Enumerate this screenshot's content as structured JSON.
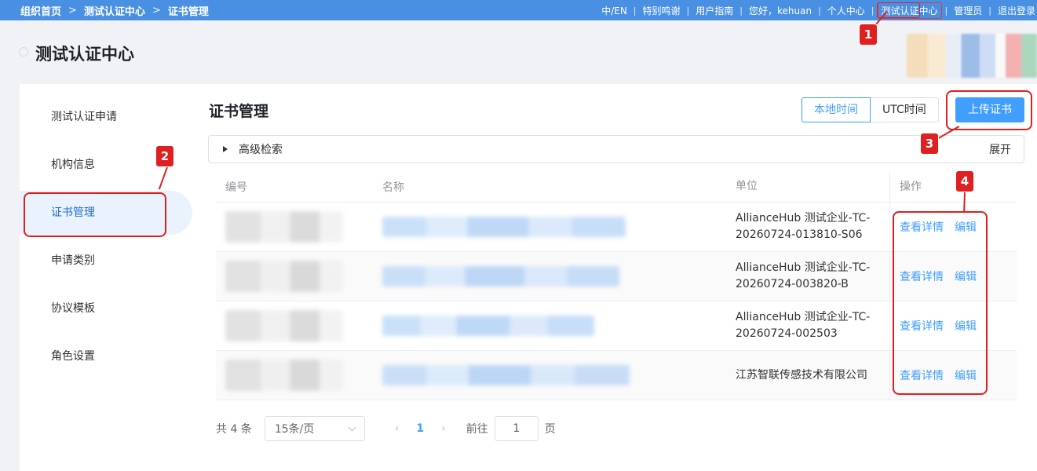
{
  "breadcrumb": [
    "组织首页",
    "测试认证中心",
    "证书管理"
  ],
  "topnav": [
    "中/EN",
    "特别鸣谢",
    "用户指南",
    "您好，kehuan",
    "个人中心",
    "测试认证中心",
    "管理员",
    "退出登录"
  ],
  "page_title": "测试认证中心",
  "sidebar": {
    "items": [
      {
        "label": "测试认证申请"
      },
      {
        "label": "机构信息"
      },
      {
        "label": "证书管理"
      },
      {
        "label": "申请类别"
      },
      {
        "label": "协议模板"
      },
      {
        "label": "角色设置"
      }
    ]
  },
  "content": {
    "title": "证书管理",
    "time_local": "本地时间",
    "time_utc": "UTC时间",
    "upload": "上传证书",
    "advanced_search": "高级检索",
    "expand": "展开"
  },
  "table": {
    "headers": {
      "no": "编号",
      "name": "名称",
      "unit": "单位",
      "op": "操作"
    },
    "rows": [
      {
        "unit": "AllianceHub 测试企业-TC-20260724-013810-S06"
      },
      {
        "unit": "AllianceHub 测试企业-TC-20260724-003820-B"
      },
      {
        "unit": "AllianceHub 测试企业-TC-20260724-002503"
      },
      {
        "unit": "江苏智联传感技术有限公司"
      }
    ],
    "view_label": "查看详情",
    "edit_label": "编辑"
  },
  "pagination": {
    "total": "共 4 条",
    "page_size": "15条/页",
    "current": "1",
    "goto": "前往",
    "goto_value": "1",
    "page_unit": "页"
  },
  "annotations": [
    "1",
    "2",
    "3",
    "4"
  ],
  "colors": {
    "primary": "#409eff",
    "topbar": "#4a90e2",
    "annotation": "#e02020"
  }
}
